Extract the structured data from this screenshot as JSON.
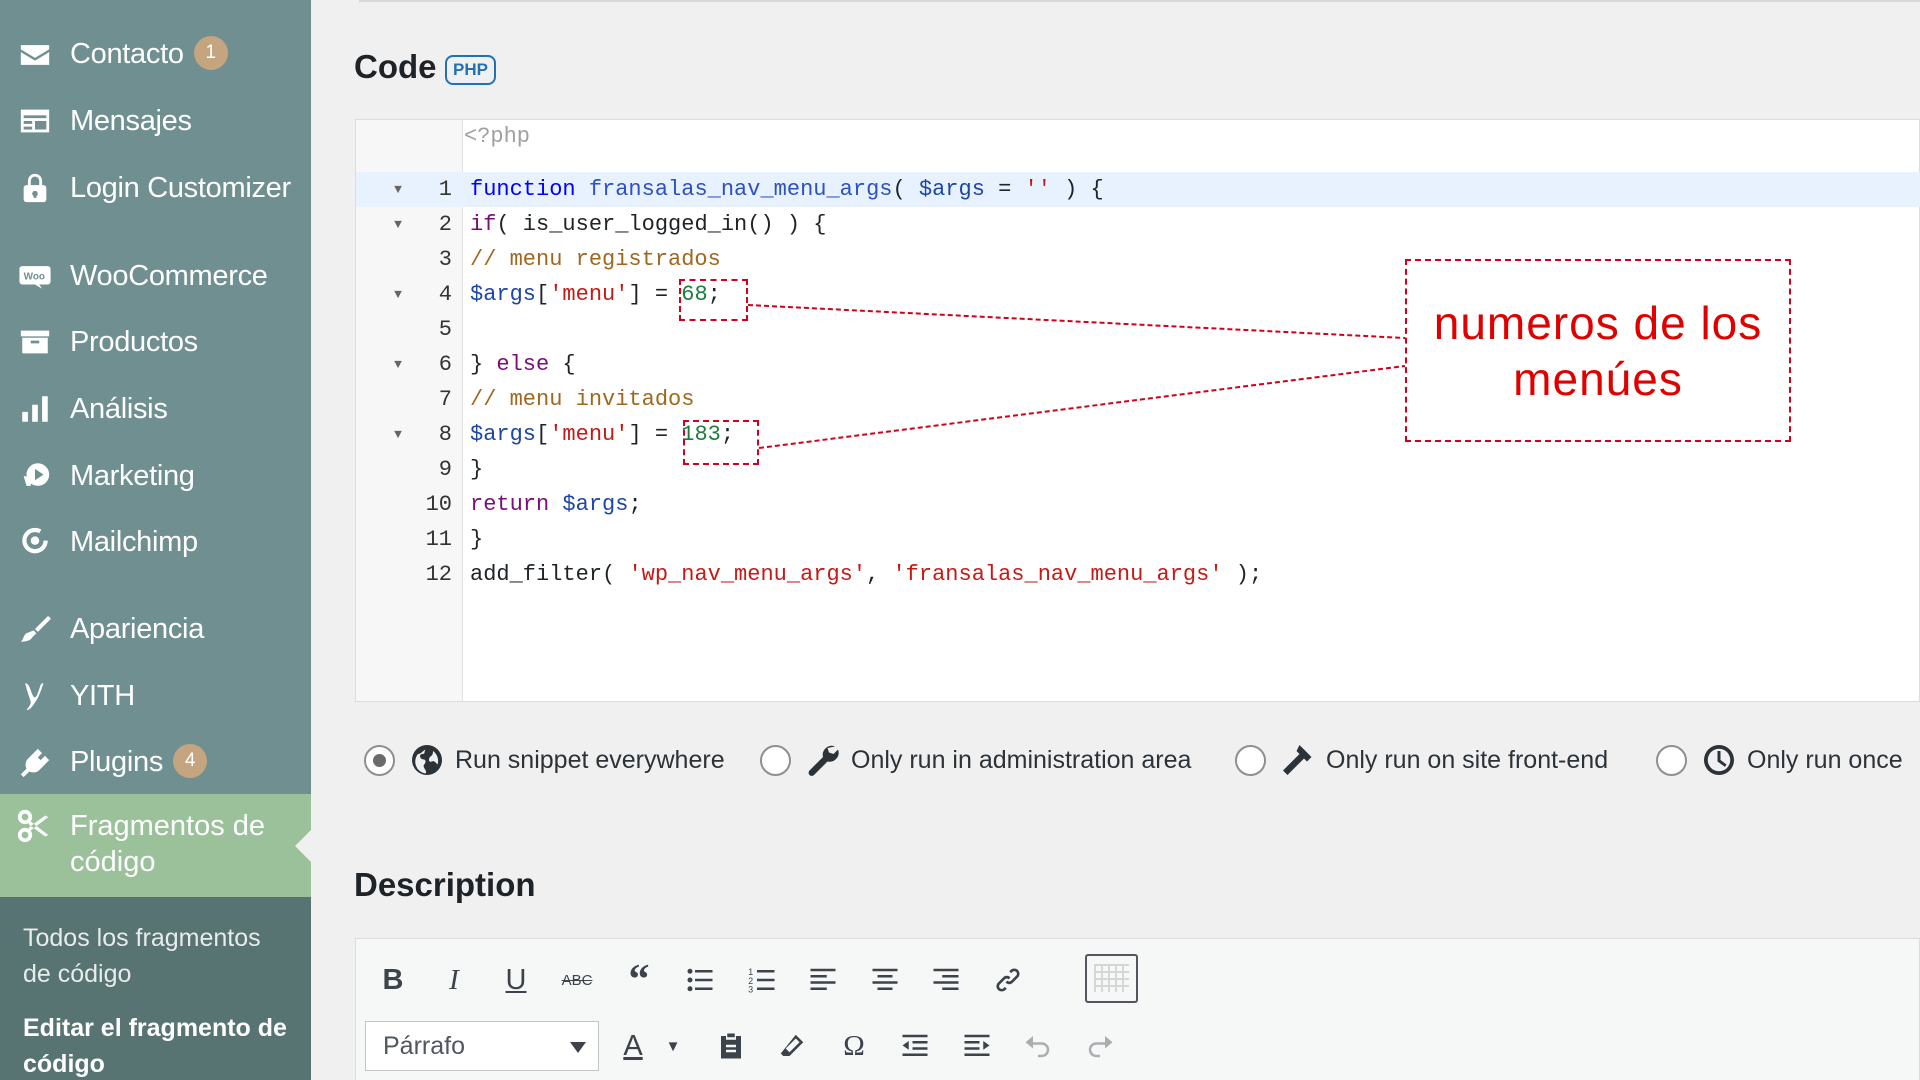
{
  "sidebar": {
    "items": [
      {
        "label": "Contacto",
        "badge": "1",
        "icon": "envelope-icon"
      },
      {
        "label": "Mensajes",
        "icon": "messages-icon"
      },
      {
        "label": "Login Customizer",
        "icon": "lock-icon"
      },
      {
        "label": "WooCommerce",
        "icon": "woo-icon"
      },
      {
        "label": "Productos",
        "icon": "archive-icon"
      },
      {
        "label": "Análisis",
        "icon": "bar-chart-icon"
      },
      {
        "label": "Marketing",
        "icon": "megaphone-icon"
      },
      {
        "label": "Mailchimp",
        "icon": "mailchimp-icon"
      },
      {
        "label": "Apariencia",
        "icon": "paintbrush-icon"
      },
      {
        "label": "YITH",
        "icon": "yith-icon"
      },
      {
        "label": "Plugins",
        "badge": "4",
        "icon": "plugin-icon"
      }
    ],
    "active": {
      "label": "Fragmentos de código",
      "icon": "scissors-icon"
    },
    "submenu": [
      {
        "label": "Todos los fragmentos de código"
      },
      {
        "label": "Editar el fragmento de código",
        "current": true
      }
    ]
  },
  "code_section": {
    "title": "Code",
    "badge": "PHP",
    "php_open_tag": "<?php",
    "lines": [
      {
        "n": "1",
        "fold": true,
        "text": "function fransalas_nav_menu_args( $args = '' ) {"
      },
      {
        "n": "2",
        "fold": true,
        "text": "if( is_user_logged_in() ) {"
      },
      {
        "n": "3",
        "fold": false,
        "text": "// menu registrados"
      },
      {
        "n": "4",
        "fold": true,
        "text": "$args['menu'] = 68;"
      },
      {
        "n": "5",
        "fold": false,
        "text": ""
      },
      {
        "n": "6",
        "fold": true,
        "text": "} else {"
      },
      {
        "n": "7",
        "fold": false,
        "text": "// menu invitados"
      },
      {
        "n": "8",
        "fold": true,
        "text": "$args['menu'] = 183;"
      },
      {
        "n": "9",
        "fold": false,
        "text": "}"
      },
      {
        "n": "10",
        "fold": false,
        "text": "return $args;"
      },
      {
        "n": "11",
        "fold": false,
        "text": "}"
      },
      {
        "n": "12",
        "fold": false,
        "text": "add_filter( 'wp_nav_menu_args', 'fransalas_nav_menu_args' );"
      }
    ],
    "annotation": "numeros de los menúes"
  },
  "scope_options": [
    {
      "label": "Run snippet everywhere",
      "icon": "globe-icon",
      "checked": true
    },
    {
      "label": "Only run in administration area",
      "icon": "wrench-icon",
      "checked": false
    },
    {
      "label": "Only run on site front-end",
      "icon": "hammer-icon",
      "checked": false
    },
    {
      "label": "Only run once",
      "icon": "clock-icon",
      "checked": false
    }
  ],
  "description": {
    "title": "Description",
    "format_select": "Párrafo",
    "toolbar_row1": [
      "bold-icon",
      "italic-icon",
      "underline-icon",
      "strikethrough-icon",
      "blockquote-icon",
      "bullet-list-icon",
      "numbered-list-icon",
      "align-left-icon",
      "align-center-icon",
      "align-right-icon",
      "link-icon",
      "kitchen-sink-icon"
    ],
    "toolbar_row2": [
      "text-color-icon",
      "paste-text-icon",
      "clear-formatting-icon",
      "special-character-icon",
      "outdent-icon",
      "indent-icon",
      "undo-icon",
      "redo-icon"
    ]
  }
}
